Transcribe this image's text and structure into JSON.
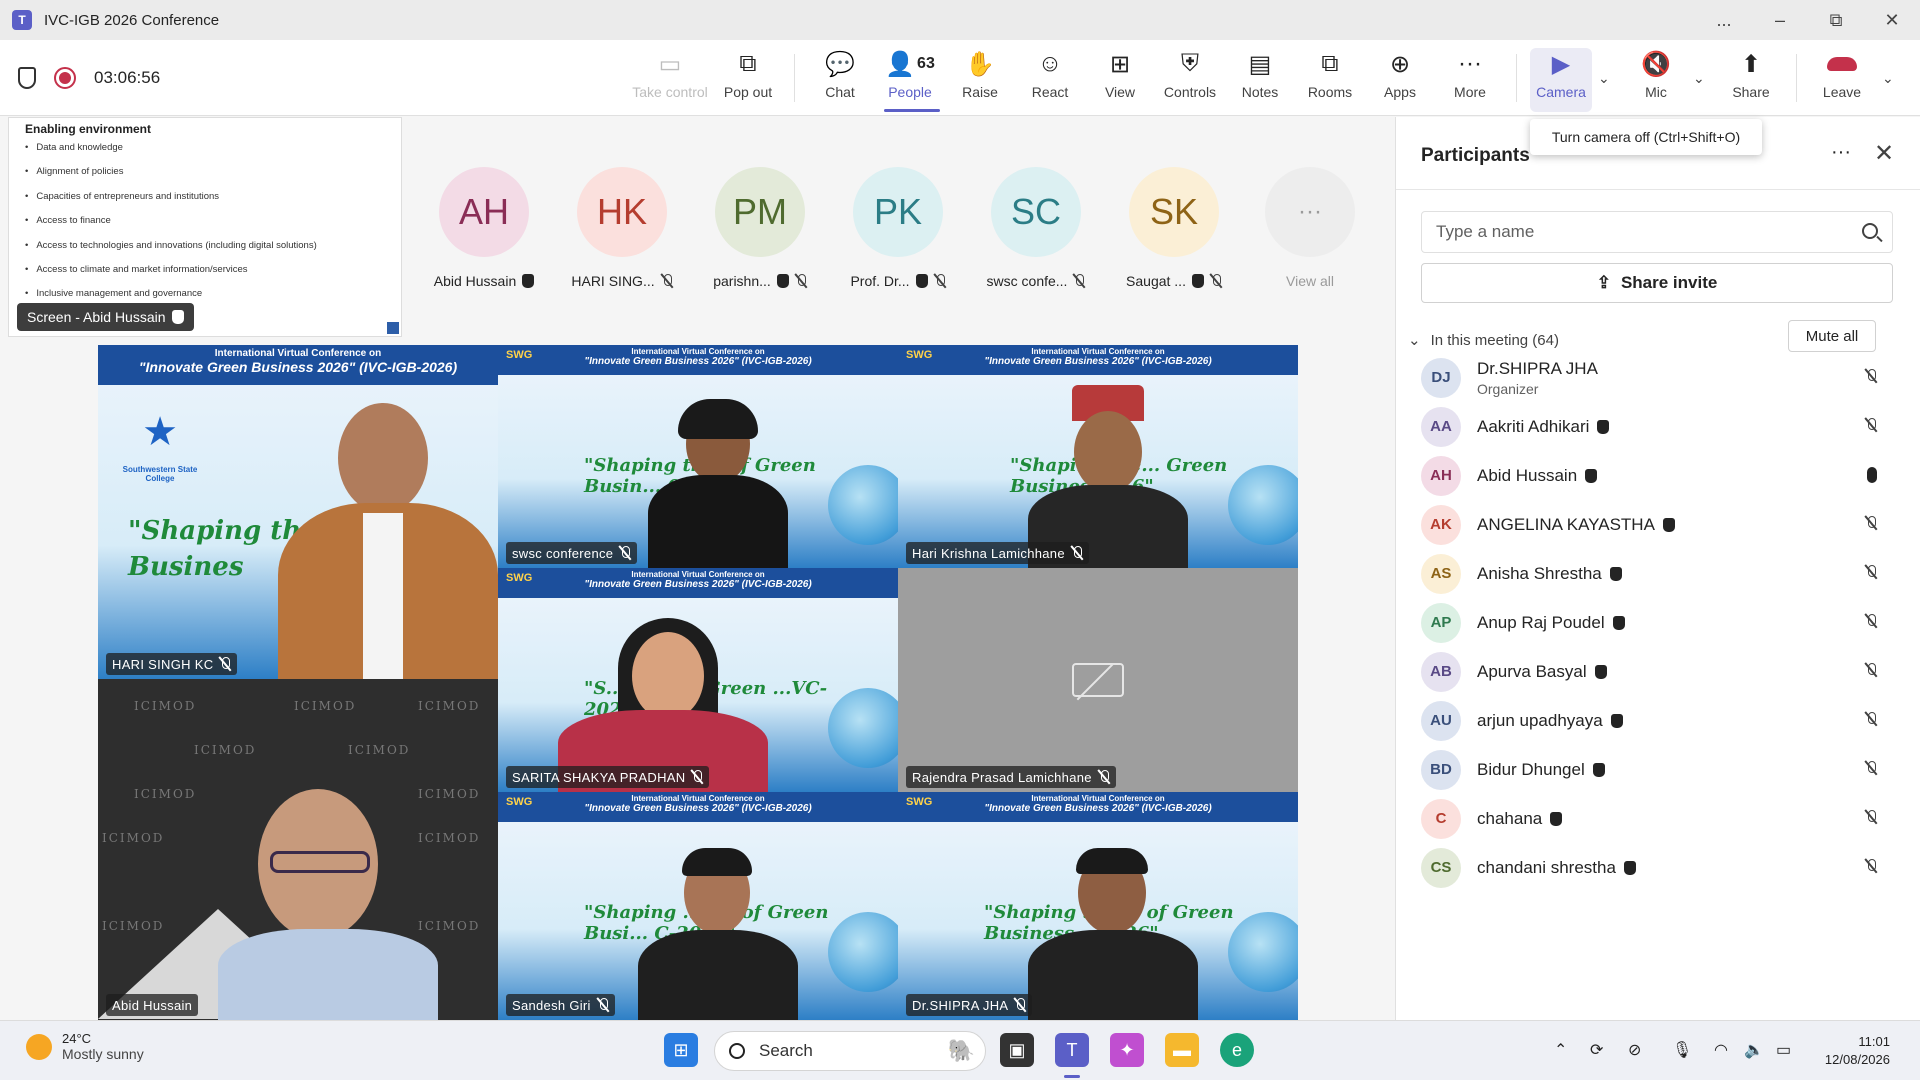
{
  "window": {
    "title": "IVC-IGB 2026 Conference",
    "controls": [
      "...",
      "–",
      "⧉",
      "✕"
    ]
  },
  "toolbar": {
    "timer": "03:06:56",
    "buttons": {
      "take_control": "Take control",
      "pop_out": "Pop out",
      "chat": "Chat",
      "people": "People",
      "people_count": "63",
      "raise": "Raise",
      "react": "React",
      "view": "View",
      "controls": "Controls",
      "notes": "Notes",
      "rooms": "Rooms",
      "apps": "Apps",
      "more": "More",
      "camera": "Camera",
      "mic": "Mic",
      "share": "Share",
      "leave": "Leave"
    },
    "camera_tooltip": "Turn camera off (Ctrl+Shift+O)"
  },
  "shared_screen": {
    "heading": "Enabling environment",
    "bullets": [
      "Data and knowledge",
      "Alignment of policies",
      "Capacities of entrepreneurs and institutions",
      "Access to finance",
      "Access to technologies and innovations (including digital solutions)",
      "Access to climate and market information/services",
      "Inclusive management and governance"
    ],
    "label": "Screen - Abid Hussain"
  },
  "avatar_strip": [
    {
      "initials": "AH",
      "name": "Abid Hussain",
      "bg": "#f3dbe6",
      "fg": "#8a2d56"
    },
    {
      "initials": "HK",
      "name": "HARI SING...",
      "bg": "#fbe0dd",
      "fg": "#b53d2f"
    },
    {
      "initials": "PM",
      "name": "parishn...",
      "bg": "#e3ead9",
      "fg": "#4f6b2f"
    },
    {
      "initials": "PK",
      "name": "Prof. Dr...",
      "bg": "#dcf0f2",
      "fg": "#2b7d86"
    },
    {
      "initials": "SC",
      "name": "swsc confe...",
      "bg": "#dcf0f2",
      "fg": "#2b7d86"
    },
    {
      "initials": "SK",
      "name": "Saugat ...",
      "bg": "#fbefd6",
      "fg": "#8e6316"
    },
    {
      "initials": "···",
      "name": "View all",
      "bg": "#ededed",
      "fg": "#9a9a9a"
    }
  ],
  "banner": {
    "line1": "International Virtual Conference on",
    "line2": "\"Innovate Green Business 2026\" (IVC-IGB-2026)",
    "logo": "SWG",
    "organizer": "Southwestern State College"
  },
  "tiles": [
    {
      "name": "HARI SINGH KC",
      "slogan": "\"Shaping the futu... Busines"
    },
    {
      "name": "swsc conference",
      "slogan": "\"Shaping th... of Green Busin... 026\""
    },
    {
      "name": "Hari Krishna Lamichhane",
      "slogan": "\"Shaping the... Green Business: ...6\""
    },
    {
      "name": "SARITA SHAKYA PRADHAN",
      "slogan": "\"S... ture of Green ...VC- 2026\""
    },
    {
      "name": "Rajendra Prasad Lamichhane",
      "slogan": ""
    },
    {
      "name": "Abid Hussain",
      "slogan": ""
    },
    {
      "name": "Sandesh Giri",
      "slogan": "\"Shaping ...ure of Green Busi... C-2026\""
    },
    {
      "name": "Dr.SHIPRA JHA",
      "slogan": "\"Shaping th... e of Green Business ...2026\""
    }
  ],
  "icimod_text": "ICIMOD",
  "panel": {
    "title": "Participants",
    "search_placeholder": "Type a name",
    "share_invite": "Share invite",
    "in_meeting": "In this meeting (64)",
    "mute_all": "Mute all",
    "participants": [
      {
        "initials": "DJ",
        "name": "Dr.SHIPRA JHA",
        "role": "Organizer",
        "bg": "#dce3f0",
        "fg": "#3a4f7a",
        "mic": "off"
      },
      {
        "initials": "AA",
        "name": "Aakriti Adhikari",
        "role": "",
        "bg": "#e6e2f0",
        "fg": "#5a4a86",
        "mic": "off"
      },
      {
        "initials": "AH",
        "name": "Abid Hussain",
        "role": "",
        "bg": "#f3dbe6",
        "fg": "#8a2d56",
        "mic": "on"
      },
      {
        "initials": "AK",
        "name": "ANGELINA KAYASTHA",
        "role": "",
        "bg": "#fbe0dd",
        "fg": "#b53d2f",
        "mic": "off"
      },
      {
        "initials": "AS",
        "name": "Anisha Shrestha",
        "role": "",
        "bg": "#fbefd6",
        "fg": "#8e6316",
        "mic": "off"
      },
      {
        "initials": "AP",
        "name": "Anup Raj Poudel",
        "role": "",
        "bg": "#dcf0e4",
        "fg": "#2f7a4f",
        "mic": "off"
      },
      {
        "initials": "AB",
        "name": "Apurva Basyal",
        "role": "",
        "bg": "#e6e2f0",
        "fg": "#5a4a86",
        "mic": "off"
      },
      {
        "initials": "AU",
        "name": "arjun upadhyaya",
        "role": "",
        "bg": "#dce3f0",
        "fg": "#3a4f7a",
        "mic": "off"
      },
      {
        "initials": "BD",
        "name": "Bidur Dhungel",
        "role": "",
        "bg": "#dce3f0",
        "fg": "#3a4f7a",
        "mic": "off"
      },
      {
        "initials": "C",
        "name": "chahana",
        "role": "",
        "bg": "#fbe0dd",
        "fg": "#b53d2f",
        "mic": "off"
      },
      {
        "initials": "CS",
        "name": "chandani shrestha",
        "role": "",
        "bg": "#e3ead9",
        "fg": "#4f6b2f",
        "mic": "off"
      }
    ]
  },
  "taskbar": {
    "weather_temp": "24°C",
    "weather_cond": "Mostly sunny",
    "search": "Search",
    "time": "11:01",
    "date": "12/08/2026"
  },
  "colors": {
    "accent": "#5b5fc7",
    "leave": "#c4314b",
    "record": "#c4314b"
  }
}
